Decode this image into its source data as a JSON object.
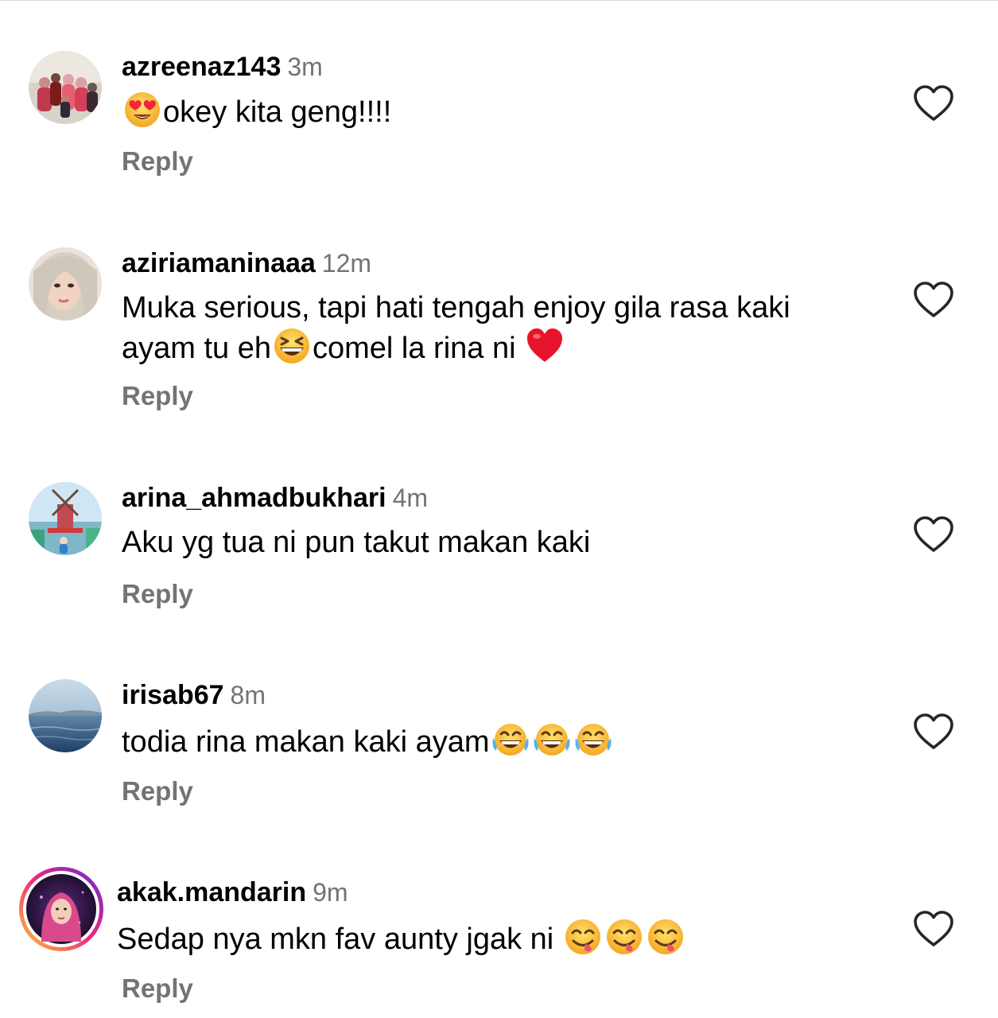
{
  "comments": [
    {
      "username": "azreenaz143",
      "time": "3m",
      "text_before": "",
      "text_after": "okey kita geng!!!!",
      "emoji": "heart-eyes-emoji",
      "reply_label": "Reply",
      "avatar": "family-photo-avatar"
    },
    {
      "username": "aziriamaninaaa",
      "time": "12m",
      "text_line1": "Muka serious, tapi hati tengah enjoy gila rasa kaki",
      "text_line2_a": "ayam tu eh",
      "text_line2_b": "comel la rina ni ",
      "emoji_a": "grinning-squinting-emoji",
      "emoji_b": "red-heart-emoji",
      "reply_label": "Reply",
      "avatar": "woman-hijab-avatar"
    },
    {
      "username": "arina_ahmadbukhari",
      "time": "4m",
      "text": "Aku yg tua ni pun takut makan kaki",
      "reply_label": "Reply",
      "avatar": "windmill-park-avatar"
    },
    {
      "username": "irisab67",
      "time": "8m",
      "text": "todia rina makan kaki ayam",
      "emoji": "tears-of-joy-emoji",
      "emoji_count": 3,
      "reply_label": "Reply",
      "avatar": "sea-landscape-avatar"
    },
    {
      "username": "akak.mandarin",
      "time": "9m",
      "text": "Sedap nya mkn fav aunty jgak ni ",
      "emoji": "face-savoring-food-emoji",
      "emoji_count": 3,
      "reply_label": "Reply",
      "avatar": "woman-pink-hijab-story-avatar"
    }
  ],
  "colors": {
    "username": "#000000",
    "secondary": "#737373",
    "heart_outline": "#262626",
    "story_ring_start": "#f9ce34",
    "story_ring_mid": "#ee2a7b",
    "story_ring_end": "#6228d7"
  }
}
